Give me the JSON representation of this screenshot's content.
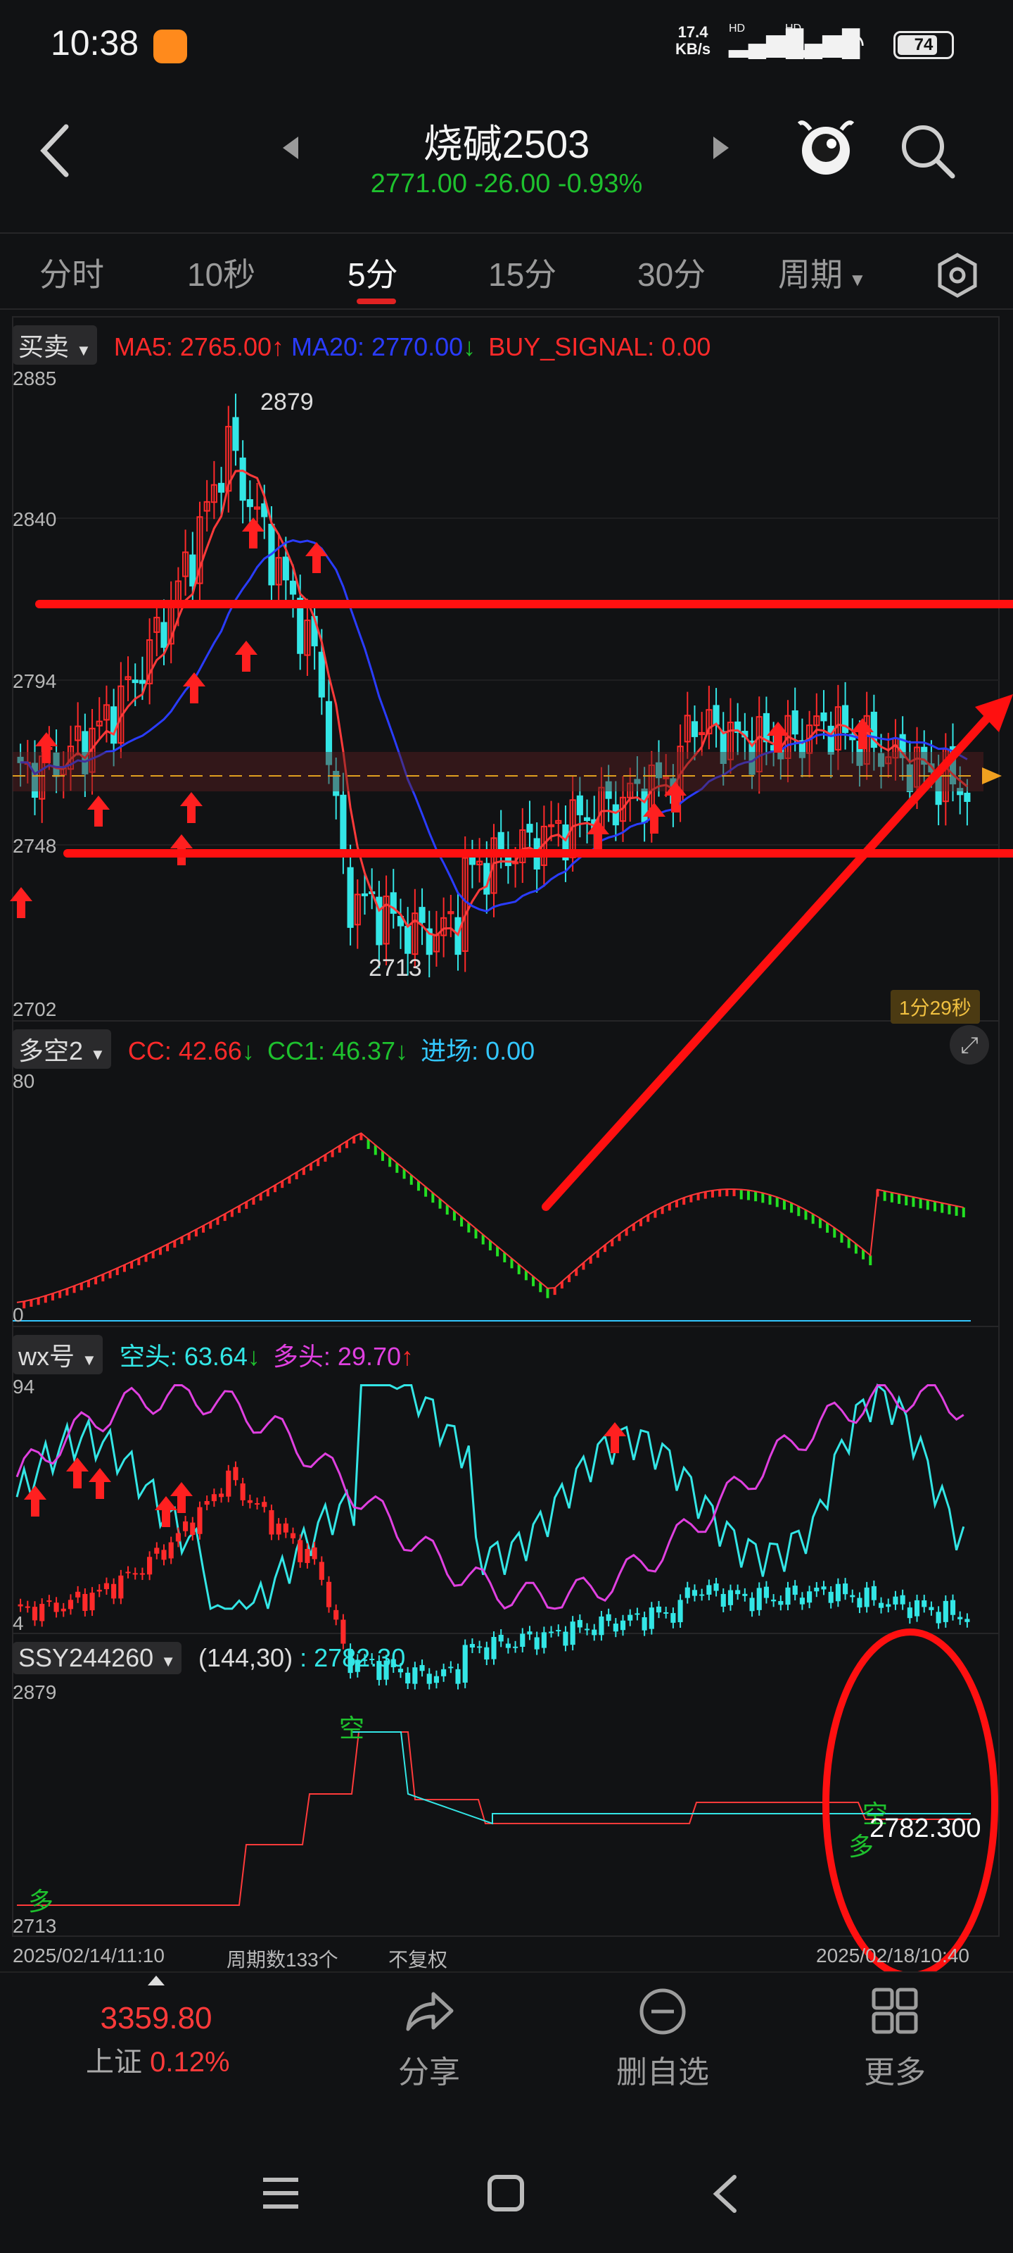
{
  "status": {
    "time": "10:38",
    "speed_top": "17.4",
    "speed_bot": "KB/s",
    "hd1": "HD",
    "hd2": "HD",
    "battery": "74"
  },
  "header": {
    "title": "烧碱2503",
    "price_line": "2771.00 -26.00 -0.93%"
  },
  "tabs": [
    {
      "label": "分时"
    },
    {
      "label": "10秒"
    },
    {
      "label": "5分"
    },
    {
      "label": "15分"
    },
    {
      "label": "30分"
    },
    {
      "label": "周期"
    }
  ],
  "panel1": {
    "selector": "买卖",
    "ma5": "MA5: 2765.00",
    "ma20": "MA20: 2770.00",
    "buy_signal": "BUY_SIGNAL: 0.00",
    "y_labels": [
      "2885",
      "2840",
      "2794",
      "2748",
      "2702"
    ],
    "high_label": "2879",
    "low_label": "2713",
    "countdown": "1分29秒"
  },
  "panel2": {
    "selector": "多空2",
    "cc": "CC: 42.66",
    "cc1": "CC1: 46.37",
    "entry": "进场: 0.00",
    "y_top": "80",
    "y_bot": "0"
  },
  "panel3": {
    "selector": "wx号",
    "short": "空头: 63.64",
    "long": "多头: 29.70",
    "y_top": "94",
    "y_bot": "4"
  },
  "panel4": {
    "selector": "SSY244260",
    "params": "(144,30)",
    "value": ": 2782.30",
    "y_top": "2879",
    "y_bot": "2713",
    "kong1": "空",
    "kong2": "空",
    "duo1": "多",
    "duo2": "多",
    "price_tag": "2782.300"
  },
  "footer_axis": {
    "start": "2025/02/14/11:10",
    "count": "周期数133个",
    "adj": "不复权",
    "end": "2025/02/18/10:40"
  },
  "bottomnav": {
    "index_value": "3359.80",
    "index_name": "上证",
    "index_change": "0.12%",
    "share": "分享",
    "remove": "删自选",
    "more": "更多"
  },
  "colors": {
    "up": "#ff2a2a",
    "down": "#33e6e6",
    "green": "#1ec12e",
    "bg": "#111214"
  }
}
